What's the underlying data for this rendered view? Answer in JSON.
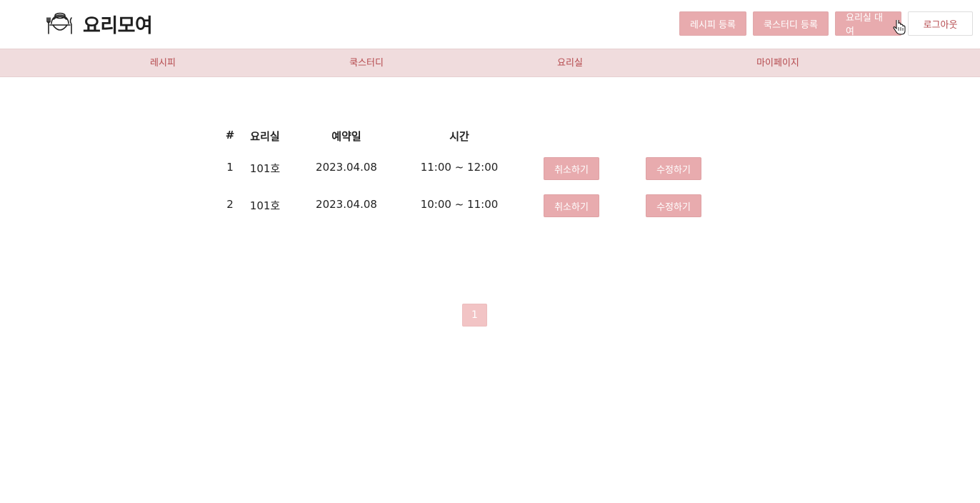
{
  "header": {
    "logo_text": "요리모여",
    "buttons": [
      {
        "label": "레시피 등록"
      },
      {
        "label": "쿡스터디 등록"
      },
      {
        "label": "요리실 대여"
      },
      {
        "label": "로그아웃"
      }
    ]
  },
  "nav": {
    "items": [
      {
        "label": "레시피"
      },
      {
        "label": "쿡스터디"
      },
      {
        "label": "요리실"
      },
      {
        "label": "마이페이지"
      }
    ]
  },
  "table": {
    "headers": [
      "#",
      "요리실",
      "예약일",
      "시간"
    ],
    "rows": [
      {
        "no": "1",
        "room": "101호",
        "date": "2023.04.08",
        "time": "11:00 ~ 12:00",
        "cancel": "취소하기",
        "edit": "수정하기"
      },
      {
        "no": "2",
        "room": "101호",
        "date": "2023.04.08",
        "time": "10:00 ~ 11:00",
        "cancel": "취소하기",
        "edit": "수정하기"
      }
    ]
  },
  "pagination": {
    "current": "1"
  },
  "colors": {
    "accent": "#e8abae",
    "nav_bg": "#f0dcdd",
    "nav_text": "#b5494d",
    "pager_active": "#f2c4c5"
  }
}
